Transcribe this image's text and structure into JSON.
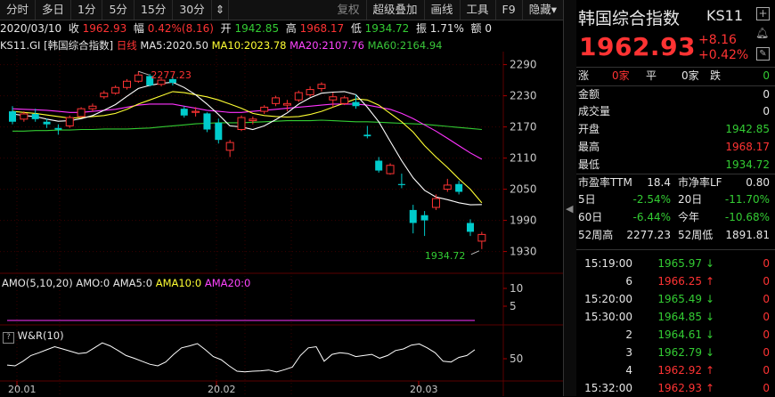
{
  "toolbar": {
    "items": [
      "分时",
      "多日",
      "1分",
      "5分",
      "15分",
      "30分",
      "复权",
      "超级叠加",
      "画线",
      "工具",
      "F9",
      "隐藏"
    ],
    "more_glyph": "⇕",
    "menu_glyph": "▾"
  },
  "infobar": {
    "date": "2020/03/10",
    "close_label": "收",
    "close": "1962.93",
    "change_label": "幅",
    "change": "0.42%(8.16)",
    "open_label": "开",
    "open": "1942.85",
    "high_label": "高",
    "high": "1968.17",
    "low_label": "低",
    "low": "1934.72",
    "amp_label": "振",
    "amp": "1.71%",
    "amount_label": "额",
    "amount": "0"
  },
  "mabar": {
    "code": "KS11.GI",
    "name": "[韩国综合指数]",
    "period": "日线",
    "ma5": "MA5:2020.50",
    "ma10": "MA10:2023.78",
    "ma20": "MA20:2107.76",
    "ma60": "MA60:2164.94"
  },
  "colors": {
    "up": "#ff3333",
    "down": "#00cccc",
    "ma5": "#ffffff",
    "ma10": "#ffff33",
    "ma20": "#ff33ff",
    "ma60": "#33cc33",
    "grid": "#3a0000"
  },
  "chart_data": {
    "type": "candlestick",
    "y_ticks": [
      "2290",
      "2230",
      "2170",
      "2110",
      "2050",
      "1990",
      "1930"
    ],
    "ylim": [
      1895,
      2315
    ],
    "x_ticks": [
      "20.01",
      "20.02",
      "20.03"
    ],
    "high_marker": "2277.23",
    "low_marker": "1934.72",
    "candles": [
      {
        "o": 2200,
        "h": 2210,
        "l": 2175,
        "c": 2180
      },
      {
        "o": 2185,
        "h": 2200,
        "l": 2180,
        "c": 2195
      },
      {
        "o": 2195,
        "h": 2205,
        "l": 2180,
        "c": 2185
      },
      {
        "o": 2180,
        "h": 2186,
        "l": 2168,
        "c": 2175
      },
      {
        "o": 2168,
        "h": 2175,
        "l": 2155,
        "c": 2165
      },
      {
        "o": 2172,
        "h": 2192,
        "l": 2168,
        "c": 2188
      },
      {
        "o": 2190,
        "h": 2208,
        "l": 2188,
        "c": 2205
      },
      {
        "o": 2205,
        "h": 2215,
        "l": 2200,
        "c": 2210
      },
      {
        "o": 2228,
        "h": 2240,
        "l": 2224,
        "c": 2235
      },
      {
        "o": 2235,
        "h": 2250,
        "l": 2232,
        "c": 2246
      },
      {
        "o": 2246,
        "h": 2262,
        "l": 2242,
        "c": 2258
      },
      {
        "o": 2258,
        "h": 2277,
        "l": 2255,
        "c": 2270
      },
      {
        "o": 2268,
        "h": 2272,
        "l": 2248,
        "c": 2250
      },
      {
        "o": 2252,
        "h": 2263,
        "l": 2248,
        "c": 2260
      },
      {
        "o": 2262,
        "h": 2266,
        "l": 2250,
        "c": 2255
      },
      {
        "o": 2205,
        "h": 2210,
        "l": 2188,
        "c": 2192
      },
      {
        "o": 2198,
        "h": 2208,
        "l": 2190,
        "c": 2200
      },
      {
        "o": 2196,
        "h": 2198,
        "l": 2160,
        "c": 2165
      },
      {
        "o": 2178,
        "h": 2186,
        "l": 2138,
        "c": 2145
      },
      {
        "o": 2125,
        "h": 2145,
        "l": 2112,
        "c": 2140
      },
      {
        "o": 2165,
        "h": 2192,
        "l": 2162,
        "c": 2188
      },
      {
        "o": 2182,
        "h": 2190,
        "l": 2175,
        "c": 2185
      },
      {
        "o": 2200,
        "h": 2212,
        "l": 2195,
        "c": 2208
      },
      {
        "o": 2215,
        "h": 2230,
        "l": 2210,
        "c": 2226
      },
      {
        "o": 2212,
        "h": 2222,
        "l": 2200,
        "c": 2215
      },
      {
        "o": 2222,
        "h": 2240,
        "l": 2218,
        "c": 2236
      },
      {
        "o": 2232,
        "h": 2248,
        "l": 2228,
        "c": 2242
      },
      {
        "o": 2244,
        "h": 2256,
        "l": 2238,
        "c": 2252
      },
      {
        "o": 2222,
        "h": 2236,
        "l": 2208,
        "c": 2228
      },
      {
        "o": 2215,
        "h": 2230,
        "l": 2212,
        "c": 2226
      },
      {
        "o": 2218,
        "h": 2232,
        "l": 2205,
        "c": 2210
      },
      {
        "o": 2155,
        "h": 2172,
        "l": 2148,
        "c": 2152
      },
      {
        "o": 2105,
        "h": 2112,
        "l": 2082,
        "c": 2086
      },
      {
        "o": 2080,
        "h": 2100,
        "l": 2078,
        "c": 2096
      },
      {
        "o": 2060,
        "h": 2080,
        "l": 2052,
        "c": 2058
      },
      {
        "o": 2010,
        "h": 2020,
        "l": 1965,
        "c": 1985
      },
      {
        "o": 2000,
        "h": 2008,
        "l": 1960,
        "c": 1990
      },
      {
        "o": 2015,
        "h": 2040,
        "l": 2010,
        "c": 2032
      },
      {
        "o": 2050,
        "h": 2070,
        "l": 2045,
        "c": 2058
      },
      {
        "o": 2060,
        "h": 2066,
        "l": 2040,
        "c": 2045
      },
      {
        "o": 1985,
        "h": 1992,
        "l": 1960,
        "c": 1968
      },
      {
        "o": 1950,
        "h": 1968,
        "l": 1934.72,
        "c": 1962.93
      }
    ],
    "ma5": [
      2195,
      2192,
      2190,
      2185,
      2181,
      2182,
      2186,
      2192,
      2202,
      2213,
      2229,
      2244,
      2250,
      2254,
      2256,
      2246,
      2232,
      2214,
      2194,
      2172,
      2170,
      2165,
      2172,
      2184,
      2197,
      2214,
      2226,
      2235,
      2237,
      2238,
      2232,
      2208,
      2180,
      2142,
      2105,
      2072,
      2048,
      2035,
      2030,
      2024,
      2020,
      2020.5
    ],
    "ma10": [
      2200,
      2198,
      2196,
      2193,
      2190,
      2187,
      2188,
      2190,
      2192,
      2196,
      2204,
      2214,
      2222,
      2230,
      2238,
      2236,
      2232,
      2228,
      2222,
      2214,
      2206,
      2196,
      2192,
      2190,
      2189,
      2190,
      2194,
      2200,
      2208,
      2216,
      2224,
      2222,
      2212,
      2196,
      2180,
      2160,
      2134,
      2112,
      2092,
      2070,
      2050,
      2023.78
    ],
    "ma20": [
      2205,
      2204,
      2203,
      2202,
      2200,
      2198,
      2198,
      2200,
      2202,
      2204,
      2208,
      2212,
      2214,
      2214,
      2214,
      2210,
      2206,
      2202,
      2200,
      2198,
      2198,
      2200,
      2202,
      2204,
      2206,
      2208,
      2210,
      2212,
      2214,
      2214,
      2214,
      2212,
      2208,
      2204,
      2196,
      2186,
      2174,
      2162,
      2148,
      2134,
      2120,
      2107.76
    ],
    "ma60": [
      2162,
      2162,
      2163,
      2163,
      2164,
      2164,
      2165,
      2165,
      2166,
      2166,
      2166,
      2167,
      2168,
      2170,
      2172,
      2174,
      2176,
      2177,
      2178,
      2178,
      2178,
      2179,
      2180,
      2181,
      2182,
      2182,
      2182,
      2183,
      2182,
      2181,
      2180,
      2180,
      2179,
      2178,
      2177,
      2176,
      2175,
      2173,
      2171,
      2169,
      2167,
      2164.94
    ]
  },
  "amo": {
    "label": "AMO(5,10,20)",
    "amo": "AMO:0",
    "ama5": "AMA5:0",
    "ama10": "AMA10:0",
    "ama20": "AMA20:0",
    "y_ticks": [
      "10",
      "5"
    ]
  },
  "wr": {
    "label": "W&R(10)",
    "help": "?",
    "y_tick": "50",
    "values": [
      30,
      28,
      40,
      55,
      62,
      70,
      78,
      72,
      66,
      60,
      62,
      75,
      88,
      80,
      68,
      55,
      48,
      40,
      32,
      28,
      38,
      58,
      75,
      80,
      86,
      70,
      52,
      44,
      28,
      14,
      12,
      14,
      15,
      17,
      12,
      18,
      25,
      55,
      75,
      78,
      40,
      58,
      62,
      60,
      52,
      55,
      58,
      48,
      55,
      68,
      72,
      82,
      85,
      75,
      62,
      40,
      38,
      50,
      55,
      70
    ]
  },
  "panel": {
    "title": "韩国综合指数",
    "code": "KS11",
    "price": "1962.93",
    "change": "+8.16",
    "change_pct": "+0.42%",
    "breadth": {
      "up_label": "涨",
      "up": "0家",
      "flat_label": "平",
      "flat": "0家",
      "down_label": "跌",
      "down": "0"
    },
    "stats": [
      {
        "label": "金额",
        "value": "0"
      },
      {
        "label": "成交量",
        "value": "0"
      },
      {
        "label": "开盘",
        "value": "1942.85"
      },
      {
        "label": "最高",
        "value": "1968.17"
      },
      {
        "label": "最低",
        "value": "1934.72"
      }
    ],
    "ratios": [
      {
        "l1": "市盈率TTM",
        "v1": "18.4",
        "l2": "市净率LF",
        "v2": "0.80"
      },
      {
        "l1": "5日",
        "v1": "-2.54%",
        "l2": "20日",
        "v2": "-11.70%"
      },
      {
        "l1": "60日",
        "v1": "-6.44%",
        "l2": "今年",
        "v2": "-10.68%"
      },
      {
        "l1": "52周高",
        "v1": "2277.23",
        "l2": "52周低",
        "v2": "1891.81"
      }
    ],
    "ticks": [
      {
        "time": "15:19:00",
        "price": "1965.97",
        "dir": "down",
        "vol": "0"
      },
      {
        "time": "6",
        "price": "1966.25",
        "dir": "up",
        "vol": "0"
      },
      {
        "time": "15:20:00",
        "price": "1965.49",
        "dir": "down",
        "vol": "0"
      },
      {
        "time": "15:30:00",
        "price": "1964.85",
        "dir": "down",
        "vol": "0"
      },
      {
        "time": "2",
        "price": "1964.61",
        "dir": "down",
        "vol": "0"
      },
      {
        "time": "3",
        "price": "1962.79",
        "dir": "down",
        "vol": "0"
      },
      {
        "time": "4",
        "price": "1962.92",
        "dir": "up",
        "vol": "0"
      },
      {
        "time": "15:32:00",
        "price": "1962.93",
        "dir": "up",
        "vol": "0"
      }
    ]
  }
}
